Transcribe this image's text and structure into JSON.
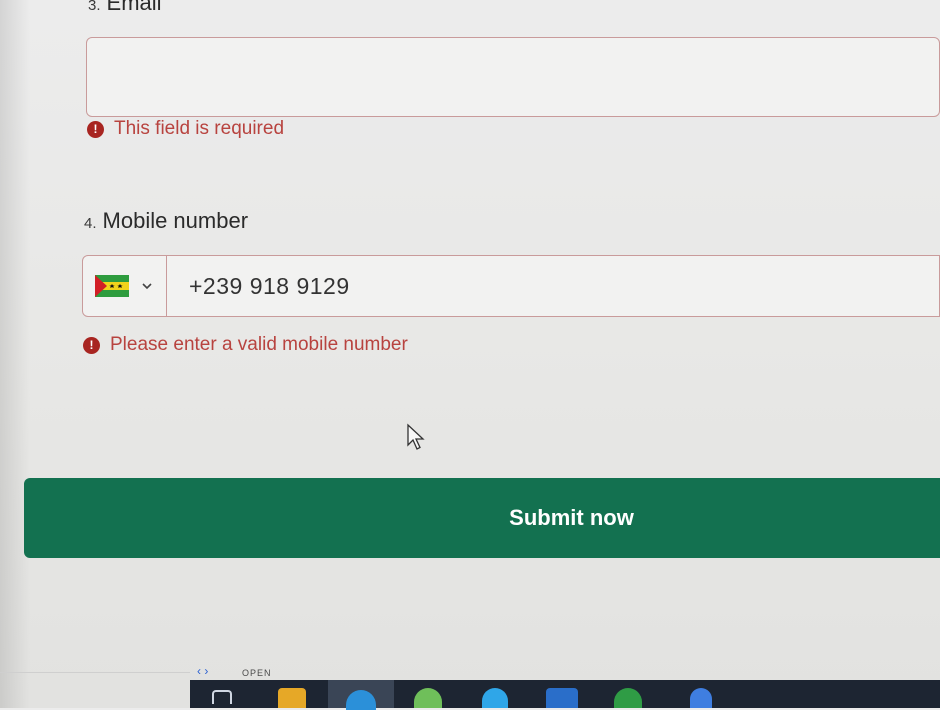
{
  "form": {
    "email": {
      "number": "3.",
      "label": "Email",
      "value": "",
      "error": "This field is required"
    },
    "mobile": {
      "number": "4.",
      "label": "Mobile number",
      "country_flag": "sao-tome-and-principe-flag",
      "value": "+239 918 9129",
      "error": "Please enter a valid mobile number"
    },
    "submit_label": "Submit now"
  },
  "taskbar": {
    "open_label": "OPEN"
  },
  "colors": {
    "error": "#b8433f",
    "error_icon": "#a82521",
    "submit": "#137150",
    "field_border": "#c99b9b"
  }
}
